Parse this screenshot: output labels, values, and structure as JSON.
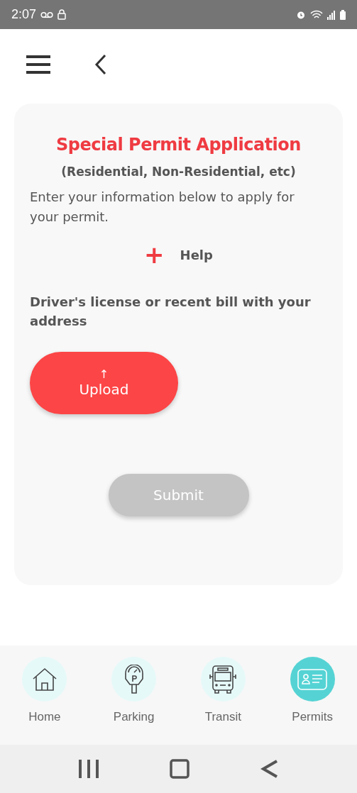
{
  "status_bar": {
    "time": "2:07"
  },
  "form": {
    "title": "Special Permit Application",
    "subtitle": "(Residential, Non-Residential, etc)",
    "intro": "Enter your information below to apply for your permit.",
    "help": {
      "icon": "+",
      "label": "Help"
    },
    "document_label": "Driver's license or recent bill with your address",
    "upload": {
      "icon": "↑",
      "label": "Upload"
    },
    "submit": {
      "label": "Submit",
      "disabled": true
    }
  },
  "tabs": [
    {
      "label": "Home",
      "kind": "home",
      "selected": false
    },
    {
      "label": "Parking",
      "kind": "parking",
      "selected": false
    },
    {
      "label": "Transit",
      "kind": "transit",
      "selected": false
    },
    {
      "label": "Permits",
      "kind": "permits",
      "selected": true
    }
  ]
}
